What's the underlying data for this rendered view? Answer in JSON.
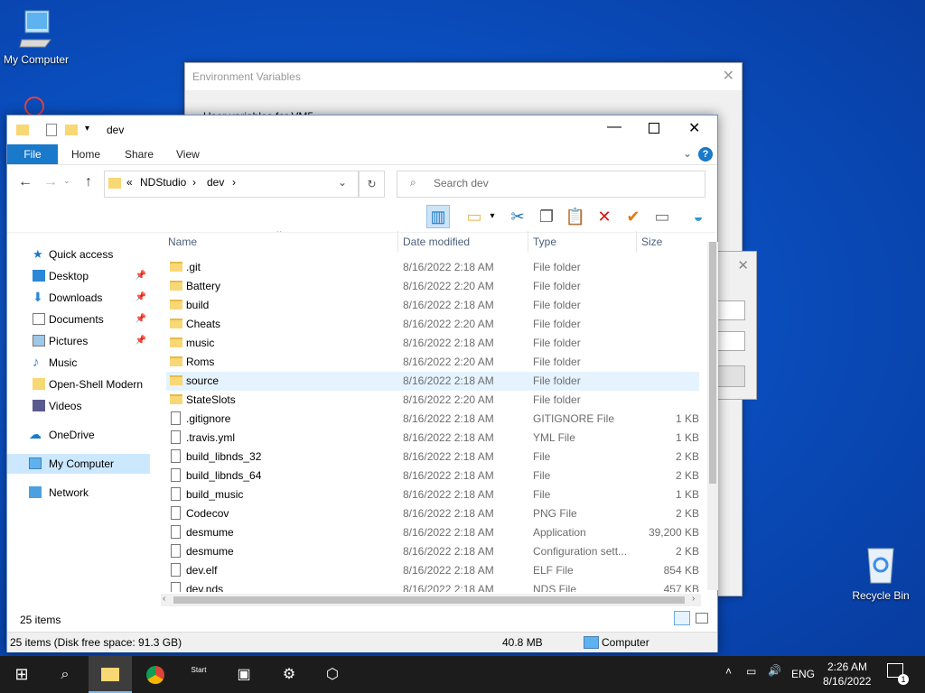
{
  "desktop": {
    "my_computer_label": "My Computer",
    "recycle_bin_label": "Recycle Bin"
  },
  "env_dialog": {
    "title": "Environment Variables",
    "partial_text": "User variables for VM5"
  },
  "explorer": {
    "title": "dev",
    "ribbon_tabs": [
      "File",
      "Home",
      "Share",
      "View"
    ],
    "address": {
      "prefix": "«",
      "crumb1": "NDStudio",
      "crumb2": "dev"
    },
    "search_placeholder": "Search dev",
    "nav": [
      {
        "label": "Quick access",
        "icon": "star-icon",
        "pinned": false
      },
      {
        "label": "Desktop",
        "icon": "desktop-icon",
        "pinned": true
      },
      {
        "label": "Downloads",
        "icon": "download-icon",
        "pinned": true
      },
      {
        "label": "Documents",
        "icon": "documents-icon",
        "pinned": true
      },
      {
        "label": "Pictures",
        "icon": "pictures-icon",
        "pinned": true
      },
      {
        "label": "Music",
        "icon": "music-icon",
        "pinned": false
      },
      {
        "label": "Open-Shell Modern",
        "icon": "folder-icon",
        "pinned": false
      },
      {
        "label": "Videos",
        "icon": "videos-icon",
        "pinned": false
      },
      {
        "label": "OneDrive",
        "icon": "cloud-icon",
        "pinned": false
      },
      {
        "label": "My Computer",
        "icon": "computer-icon",
        "pinned": false
      },
      {
        "label": "Network",
        "icon": "network-icon",
        "pinned": false
      }
    ],
    "columns": {
      "name": "Name",
      "date": "Date modified",
      "type": "Type",
      "size": "Size"
    },
    "files": [
      {
        "name": ".git",
        "date": "8/16/2022 2:18 AM",
        "type": "File folder",
        "size": "",
        "kind": "folder"
      },
      {
        "name": "Battery",
        "date": "8/16/2022 2:20 AM",
        "type": "File folder",
        "size": "",
        "kind": "folder"
      },
      {
        "name": "build",
        "date": "8/16/2022 2:18 AM",
        "type": "File folder",
        "size": "",
        "kind": "folder"
      },
      {
        "name": "Cheats",
        "date": "8/16/2022 2:20 AM",
        "type": "File folder",
        "size": "",
        "kind": "folder"
      },
      {
        "name": "music",
        "date": "8/16/2022 2:18 AM",
        "type": "File folder",
        "size": "",
        "kind": "folder"
      },
      {
        "name": "Roms",
        "date": "8/16/2022 2:20 AM",
        "type": "File folder",
        "size": "",
        "kind": "folder"
      },
      {
        "name": "source",
        "date": "8/16/2022 2:18 AM",
        "type": "File folder",
        "size": "",
        "kind": "folder"
      },
      {
        "name": "StateSlots",
        "date": "8/16/2022 2:20 AM",
        "type": "File folder",
        "size": "",
        "kind": "folder"
      },
      {
        "name": ".gitignore",
        "date": "8/16/2022 2:18 AM",
        "type": "GITIGNORE File",
        "size": "1 KB",
        "kind": "file"
      },
      {
        "name": ".travis.yml",
        "date": "8/16/2022 2:18 AM",
        "type": "YML File",
        "size": "1 KB",
        "kind": "file"
      },
      {
        "name": "build_libnds_32",
        "date": "8/16/2022 2:18 AM",
        "type": "File",
        "size": "2 KB",
        "kind": "file"
      },
      {
        "name": "build_libnds_64",
        "date": "8/16/2022 2:18 AM",
        "type": "File",
        "size": "2 KB",
        "kind": "file"
      },
      {
        "name": "build_music",
        "date": "8/16/2022 2:18 AM",
        "type": "File",
        "size": "1 KB",
        "kind": "file"
      },
      {
        "name": "Codecov",
        "date": "8/16/2022 2:18 AM",
        "type": "PNG File",
        "size": "2 KB",
        "kind": "image"
      },
      {
        "name": "desmume",
        "date": "8/16/2022 2:18 AM",
        "type": "Application",
        "size": "39,200 KB",
        "kind": "app"
      },
      {
        "name": "desmume",
        "date": "8/16/2022 2:18 AM",
        "type": "Configuration sett...",
        "size": "2 KB",
        "kind": "config"
      },
      {
        "name": "dev.elf",
        "date": "8/16/2022 2:18 AM",
        "type": "ELF File",
        "size": "854 KB",
        "kind": "file"
      },
      {
        "name": "dev.nds",
        "date": "8/16/2022 2:18 AM",
        "type": "NDS File",
        "size": "457 KB",
        "kind": "file"
      }
    ],
    "item_count": "25 items",
    "status": {
      "summary": "25 items (Disk free space: 91.3 GB)",
      "size": "40.8 MB",
      "location": "Computer"
    }
  },
  "taskbar": {
    "time": "2:26 AM",
    "date": "8/16/2022",
    "lang": "ENG",
    "notif_count": "1",
    "start_label": "Start"
  },
  "colors": {
    "accent": "#1979ca",
    "selected_row": "#e5f3ff",
    "taskbar": "#1c1c1c"
  }
}
